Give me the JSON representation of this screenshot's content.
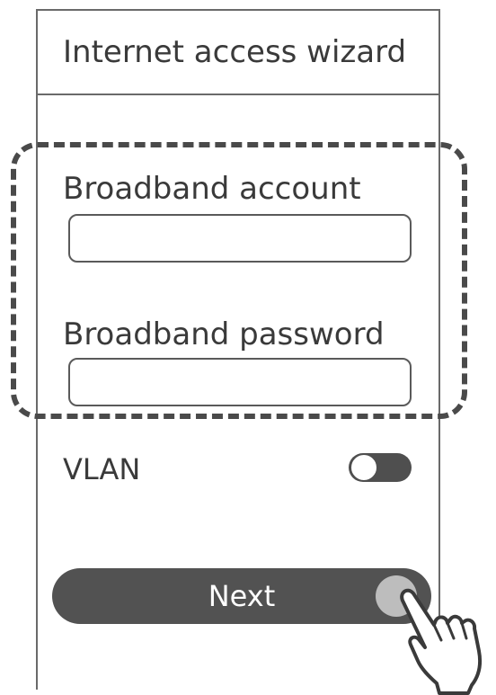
{
  "header": {
    "title": "Internet access wizard"
  },
  "form": {
    "account": {
      "label": "Broadband account",
      "value": "",
      "placeholder": ""
    },
    "password": {
      "label": "Broadband password",
      "value": "",
      "placeholder": ""
    },
    "vlan": {
      "label": "VLAN",
      "enabled": false
    }
  },
  "actions": {
    "next_label": "Next"
  },
  "icons": {
    "pointer": "hand-pointer-icon"
  },
  "colors": {
    "button": "#525252",
    "toggle": "#4f4f4f",
    "frame": "#6a6a6a",
    "text": "#3a3a3a"
  }
}
